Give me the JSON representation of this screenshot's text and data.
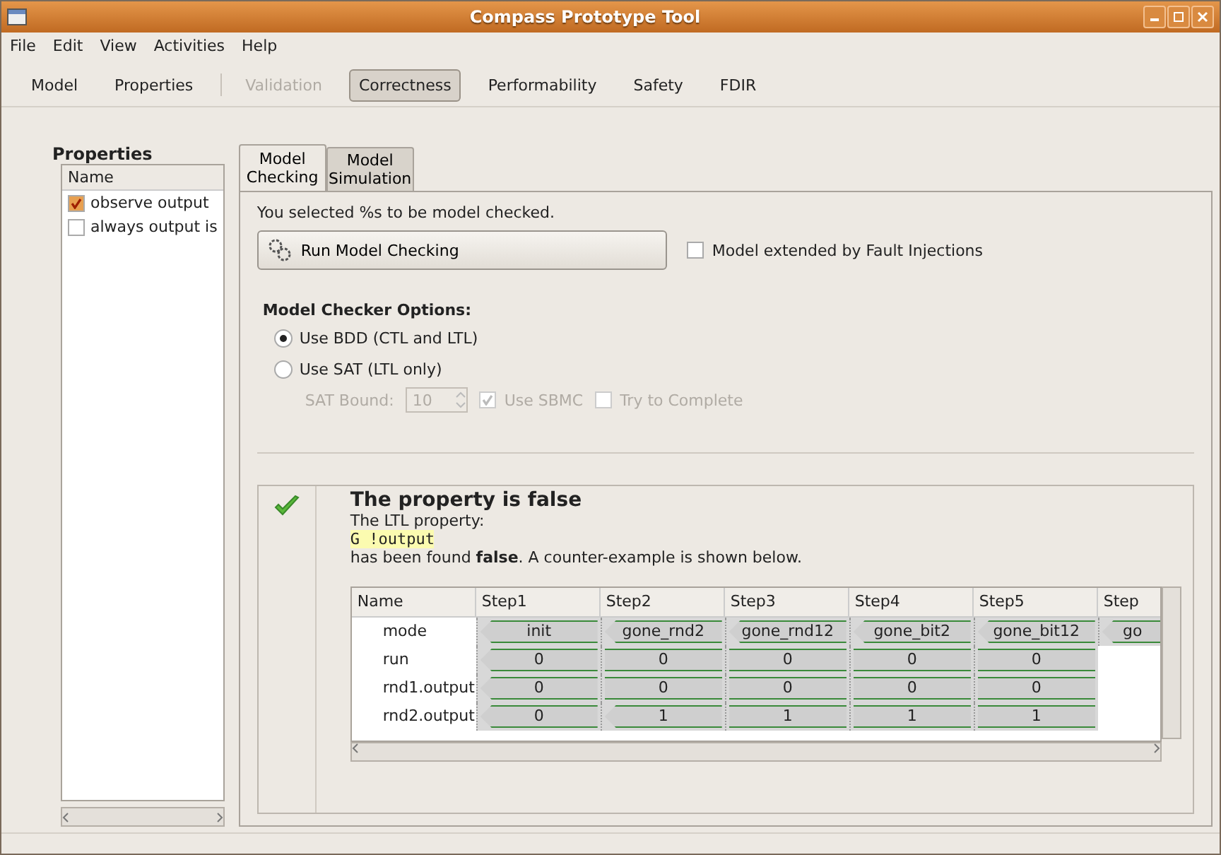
{
  "window": {
    "title": "Compass Prototype Tool"
  },
  "menu": [
    "File",
    "Edit",
    "View",
    "Activities",
    "Help"
  ],
  "toolbar": [
    {
      "label": "Model",
      "selected": false,
      "disabled": false
    },
    {
      "label": "Properties",
      "selected": false,
      "disabled": false
    },
    {
      "label": "Validation",
      "selected": false,
      "disabled": true
    },
    {
      "label": "Correctness",
      "selected": true,
      "disabled": false
    },
    {
      "label": "Performability",
      "selected": false,
      "disabled": false
    },
    {
      "label": "Safety",
      "selected": false,
      "disabled": false
    },
    {
      "label": "FDIR",
      "selected": false,
      "disabled": false
    }
  ],
  "properties": {
    "title": "Properties",
    "column": "Name",
    "items": [
      {
        "label": "observe output",
        "checked": true
      },
      {
        "label": "always output is",
        "checked": false
      }
    ]
  },
  "tabs": [
    {
      "label": "Model Checking",
      "selected": true
    },
    {
      "label": "Model Simulation",
      "selected": false
    }
  ],
  "intro": "You selected %s to be model checked.",
  "run_button": "Run Model Checking",
  "fault_injections": {
    "label": "Model extended by Fault Injections",
    "checked": false
  },
  "options": {
    "title": "Model Checker Options:",
    "radios": [
      {
        "label": "Use BDD (CTL and LTL)",
        "selected": true
      },
      {
        "label": "Use SAT (LTL only)",
        "selected": false
      }
    ],
    "sat_bound_label": "SAT Bound:",
    "sat_bound": "10",
    "sbmc": {
      "label": "Use SBMC",
      "checked": true
    },
    "complete": {
      "label": "Try to Complete",
      "checked": false
    }
  },
  "result": {
    "title": "The property is false",
    "line1": "The LTL property:",
    "formula": "G !output",
    "line2": "has been found **false**. A counter-example is shown below."
  },
  "trace": {
    "columns": [
      "Name",
      "Step1",
      "Step2",
      "Step3",
      "Step4",
      "Step5",
      "Step"
    ],
    "rows": [
      {
        "cells": [
          {
            "kind": "name",
            "value": "mode"
          },
          {
            "value": "init",
            "transition": true
          },
          {
            "value": "gone_rnd2",
            "transition": true
          },
          {
            "value": "gone_rnd12",
            "transition": true
          },
          {
            "value": "gone_bit2",
            "transition": true
          },
          {
            "value": "gone_bit12",
            "transition": true
          },
          {
            "value": "go",
            "transition": true
          }
        ]
      },
      {
        "cells": [
          {
            "kind": "name",
            "value": "run"
          },
          {
            "value": "0",
            "transition": true
          },
          {
            "value": "0",
            "transition": false
          },
          {
            "value": "0",
            "transition": false
          },
          {
            "value": "0",
            "transition": false
          },
          {
            "value": "0",
            "transition": false
          }
        ]
      },
      {
        "cells": [
          {
            "kind": "name",
            "value": "rnd1.output"
          },
          {
            "value": "0",
            "transition": true
          },
          {
            "value": "0",
            "transition": false
          },
          {
            "value": "0",
            "transition": false
          },
          {
            "value": "0",
            "transition": false
          },
          {
            "value": "0",
            "transition": false
          }
        ]
      },
      {
        "cells": [
          {
            "kind": "name",
            "value": "rnd2.output"
          },
          {
            "value": "0",
            "transition": true
          },
          {
            "value": "1",
            "transition": true
          },
          {
            "value": "1",
            "transition": false
          },
          {
            "value": "1",
            "transition": false
          },
          {
            "value": "1",
            "transition": false
          }
        ]
      }
    ]
  }
}
